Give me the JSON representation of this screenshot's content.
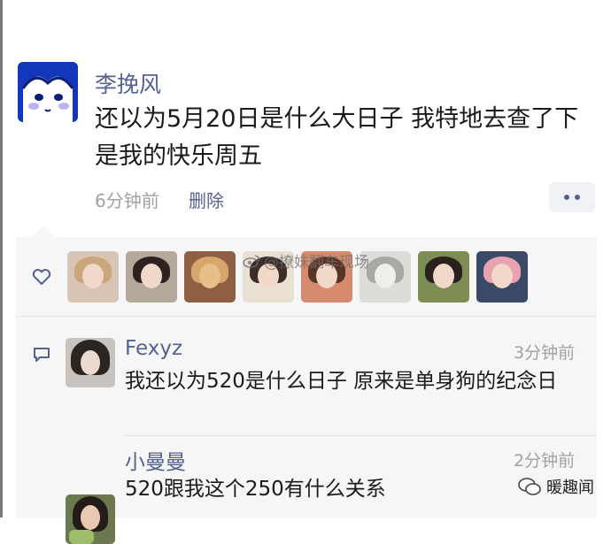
{
  "post": {
    "author": "李挽风",
    "text": "还以为5月20日是什么大日子 我特地去查了下 是我的快乐周五",
    "time": "6分钟前",
    "delete_label": "删除"
  },
  "likes": {
    "avatars": [
      "liker-1",
      "liker-2",
      "liker-3",
      "liker-4",
      "liker-5",
      "liker-6",
      "liker-7",
      "liker-8"
    ],
    "watermark": "@撩妹翻车现场"
  },
  "comments": [
    {
      "name": "Fexyz",
      "time": "3分钟前",
      "text": "我还以为520是什么日子 原来是单身狗的纪念日"
    },
    {
      "name": "小曼曼",
      "time": "2分钟前",
      "text": "520跟我这个250有什么关系"
    }
  ],
  "brand": {
    "name": "暖趣闻"
  },
  "colors": {
    "link": "#55628f",
    "meta": "#a1a1a1",
    "panel": "#f6f6f7",
    "avatar_bg": "#1237b8"
  },
  "icons": {
    "like": "heart-outline-icon",
    "comment": "comment-bubble-icon",
    "more": "more-dots-icon"
  }
}
